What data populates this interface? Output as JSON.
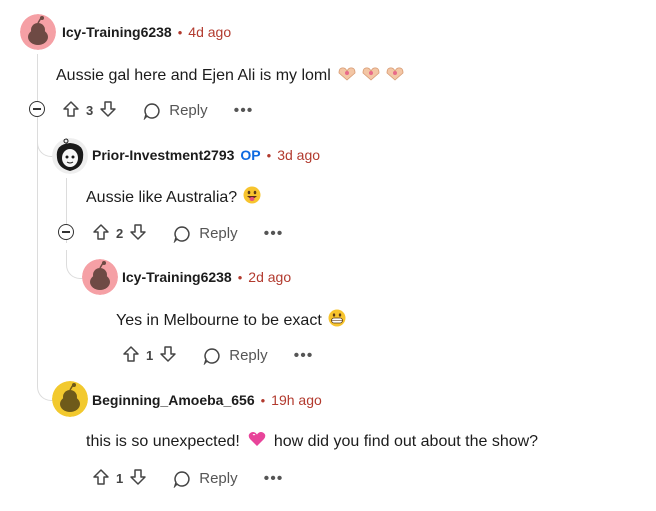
{
  "comments": [
    {
      "username": "Icy-Training6238",
      "time": "4d ago",
      "text": "Aussie gal here and Ejen Ali is my loml",
      "votes": "3",
      "reply_label": "Reply",
      "more_label": "•••",
      "avatar_color": "#f5a0a5"
    },
    {
      "username": "Prior-Investment2793",
      "op_badge": "OP",
      "time": "3d ago",
      "text": "Aussie like Australia?",
      "votes": "2",
      "reply_label": "Reply",
      "more_label": "•••"
    },
    {
      "username": "Icy-Training6238",
      "time": "2d ago",
      "text": "Yes in Melbourne to be exact",
      "votes": "1",
      "reply_label": "Reply",
      "more_label": "•••",
      "avatar_color": "#f5a0a5"
    },
    {
      "username": "Beginning_Amoeba_656",
      "time": "19h ago",
      "text_before": "this is so unexpected!",
      "text_after": "how did you find out about the show?",
      "votes": "1",
      "reply_label": "Reply",
      "more_label": "•••",
      "avatar_color": "#f2c92e"
    }
  ],
  "separator": "•",
  "colors": {
    "timestamp": "#b23a2e",
    "op": "#0e6ae0",
    "thread_line": "#dcdcdc"
  }
}
